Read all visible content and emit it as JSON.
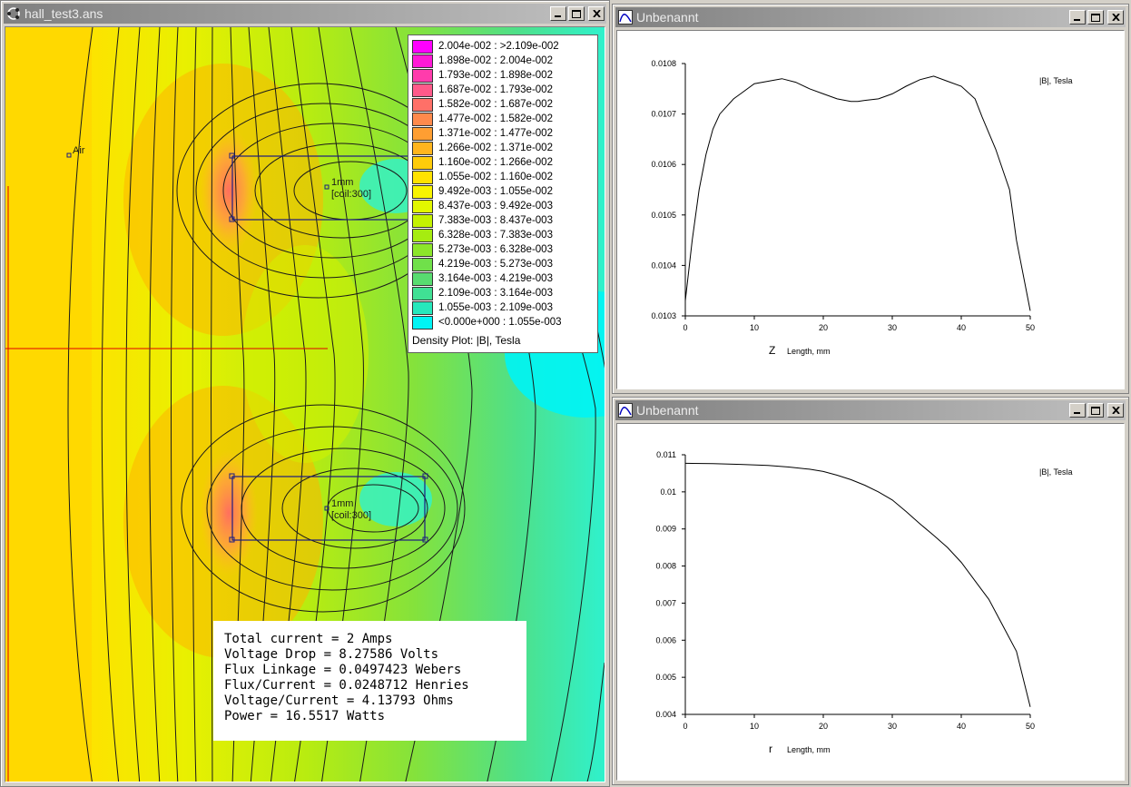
{
  "main_window": {
    "title": "hall_test3.ans",
    "labels": {
      "air": "Air",
      "coil_top_material": "1mm",
      "coil_top_circuit": "[coil:300]",
      "coil_bottom_material": "1mm",
      "coil_bottom_circuit": "[coil:300]"
    },
    "legend": {
      "caption": "Density Plot: |B|, Tesla",
      "entries": [
        {
          "range": "2.004e-002 : >2.109e-002",
          "color": "#ff00ff"
        },
        {
          "range": "1.898e-002 : 2.004e-002",
          "color": "#ff19d6"
        },
        {
          "range": "1.793e-002 : 1.898e-002",
          "color": "#ff3cac"
        },
        {
          "range": "1.687e-002 : 1.793e-002",
          "color": "#ff5a8a"
        },
        {
          "range": "1.582e-002 : 1.687e-002",
          "color": "#ff7068"
        },
        {
          "range": "1.477e-002 : 1.582e-002",
          "color": "#ff8a4c"
        },
        {
          "range": "1.371e-002 : 1.477e-002",
          "color": "#ff9e32"
        },
        {
          "range": "1.266e-002 : 1.371e-002",
          "color": "#ffb51e"
        },
        {
          "range": "1.160e-002 : 1.266e-002",
          "color": "#ffcc0a"
        },
        {
          "range": "1.055e-002 : 1.160e-002",
          "color": "#ffe200"
        },
        {
          "range": "9.492e-003 : 1.055e-002",
          "color": "#f8f400"
        },
        {
          "range": "8.437e-003 : 9.492e-003",
          "color": "#e2f800"
        },
        {
          "range": "7.383e-003 : 8.437e-003",
          "color": "#c4f200"
        },
        {
          "range": "6.328e-003 : 7.383e-003",
          "color": "#a6ec10"
        },
        {
          "range": "5.273e-003 : 6.328e-003",
          "color": "#8ce62a"
        },
        {
          "range": "4.219e-003 : 5.273e-003",
          "color": "#70e04a"
        },
        {
          "range": "3.164e-003 : 4.219e-003",
          "color": "#58dc70"
        },
        {
          "range": "2.109e-003 : 3.164e-003",
          "color": "#40e094"
        },
        {
          "range": "1.055e-003 : 2.109e-003",
          "color": "#26e8bc"
        },
        {
          "range": "<0.000e+000 : 1.055e-003",
          "color": "#00f4f4"
        }
      ]
    },
    "results": [
      "Total current = 2 Amps",
      "Voltage Drop = 8.27586 Volts",
      "Flux Linkage = 0.0497423 Webers",
      "Flux/Current = 0.0248712 Henries",
      "Voltage/Current = 4.13793 Ohms",
      "Power = 16.5517 Watts"
    ]
  },
  "plot_windows": [
    {
      "title": "Unbenannt",
      "chart_data": {
        "type": "line",
        "series_label": "|B|, Tesla",
        "xvar": "Z",
        "xlabel": "Length, mm",
        "xlim": [
          0,
          50
        ],
        "ylim": [
          0.0103,
          0.0108
        ],
        "xticks": [
          "0",
          "10",
          "20",
          "30",
          "40",
          "50"
        ],
        "yticks": [
          "0.0108",
          "0.0107",
          "0.0106",
          "0.0105",
          "0.0104",
          "0.0103"
        ],
        "x": [
          0,
          1,
          2,
          3,
          4,
          5,
          7,
          8,
          10,
          12,
          14,
          16,
          18,
          20,
          22,
          24,
          25,
          26,
          28,
          30,
          32,
          34,
          36,
          38,
          40,
          42,
          43,
          45,
          47,
          48,
          50
        ],
        "y": [
          0.01033,
          0.01045,
          0.01055,
          0.01062,
          0.01067,
          0.0107,
          0.01073,
          0.01074,
          0.01076,
          0.010765,
          0.01077,
          0.010763,
          0.01075,
          0.01074,
          0.01073,
          0.010725,
          0.010725,
          0.010727,
          0.01073,
          0.01074,
          0.010755,
          0.010768,
          0.010775,
          0.010765,
          0.010755,
          0.01073,
          0.010695,
          0.01063,
          0.01055,
          0.01045,
          0.01031
        ]
      }
    },
    {
      "title": "Unbenannt",
      "chart_data": {
        "type": "line",
        "series_label": "|B|, Tesla",
        "xvar": "r",
        "xlabel": "Length, mm",
        "xlim": [
          0,
          50
        ],
        "ylim": [
          0.004,
          0.011
        ],
        "xticks": [
          "0",
          "10",
          "20",
          "30",
          "40",
          "50"
        ],
        "yticks": [
          "0.011",
          "0.01",
          "0.009",
          "0.008",
          "0.007",
          "0.006",
          "0.005",
          "0.004"
        ],
        "x": [
          0,
          4,
          8,
          12,
          15,
          18,
          20,
          22,
          24,
          26,
          28,
          30,
          32,
          34,
          36,
          38,
          40,
          42,
          44,
          46,
          48,
          50
        ],
        "y": [
          0.01077,
          0.01076,
          0.01074,
          0.01071,
          0.01067,
          0.01061,
          0.01055,
          0.01045,
          0.01033,
          0.01018,
          0.01,
          0.00978,
          0.00947,
          0.00914,
          0.00883,
          0.0085,
          0.0081,
          0.0076,
          0.0071,
          0.0064,
          0.0057,
          0.0042
        ]
      }
    }
  ]
}
